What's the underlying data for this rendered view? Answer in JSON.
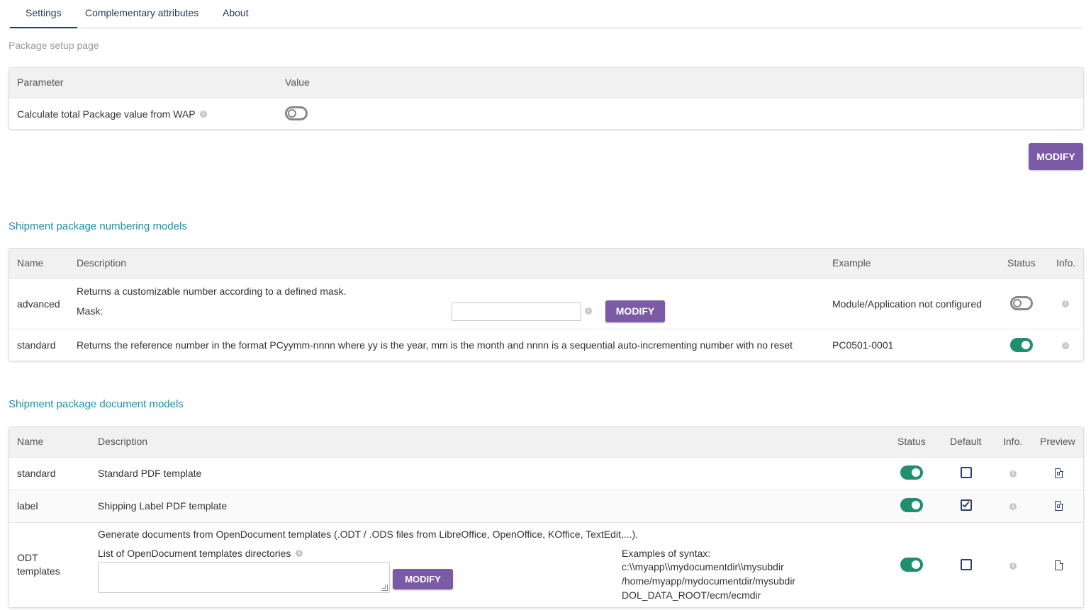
{
  "tabs": [
    {
      "label": "Settings",
      "active": true
    },
    {
      "label": "Complementary attributes",
      "active": false
    },
    {
      "label": "About",
      "active": false
    }
  ],
  "page_subtitle": "Package setup page",
  "params_table": {
    "headers": {
      "parameter": "Parameter",
      "value": "Value"
    },
    "rows": [
      {
        "label": "Calculate total Package value from WAP",
        "enabled": false
      }
    ],
    "modify_label": "MODIFY"
  },
  "numbering": {
    "title": "Shipment package numbering models",
    "headers": {
      "name": "Name",
      "description": "Description",
      "example": "Example",
      "status": "Status",
      "info": "Info."
    },
    "rows": [
      {
        "name": "advanced",
        "description": "Returns a customizable number according to a defined mask.",
        "mask_label": "Mask:",
        "mask_value": "",
        "modify_label": "MODIFY",
        "example": "Module/Application not configured",
        "status": false
      },
      {
        "name": "standard",
        "description": "Returns the reference number in the format PCyymm-nnnn where yy is the year, mm is the month and nnnn is a sequential auto-incrementing number with no reset",
        "example": "PC0501-0001",
        "status": true
      }
    ]
  },
  "documents": {
    "title": "Shipment package document models",
    "headers": {
      "name": "Name",
      "description": "Description",
      "status": "Status",
      "default": "Default",
      "info": "Info.",
      "preview": "Preview"
    },
    "rows": [
      {
        "name": "standard",
        "description": "Standard PDF template",
        "status": true,
        "default": false,
        "preview_icon": "pdf-file-icon"
      },
      {
        "name": "label",
        "description": "Shipping Label PDF template",
        "status": true,
        "default": true,
        "preview_icon": "pdf-file-icon"
      },
      {
        "name_line1": "ODT",
        "name_line2": "templates",
        "description": "Generate documents from OpenDocument templates (.ODT / .ODS files from LibreOffice, OpenOffice, KOffice, TextEdit,...).",
        "dirs_label": "List of OpenDocument templates directories",
        "dirs_value": "",
        "modify_label": "MODIFY",
        "syntax_title": "Examples of syntax:",
        "syntax_lines": [
          "c:\\\\myapp\\\\mydocumentdir\\\\mysubdir",
          "/home/myapp/mydocumentdir/mysubdir",
          "DOL_DATA_ROOT/ecm/ecmdir"
        ],
        "status": true,
        "default": false,
        "preview_icon": "file-icon"
      }
    ]
  },
  "colors": {
    "accent": "#7b5aa6",
    "toggle_on": "#1f8f6c",
    "section_title": "#1a8fa7",
    "tab_text": "#263c5c"
  }
}
